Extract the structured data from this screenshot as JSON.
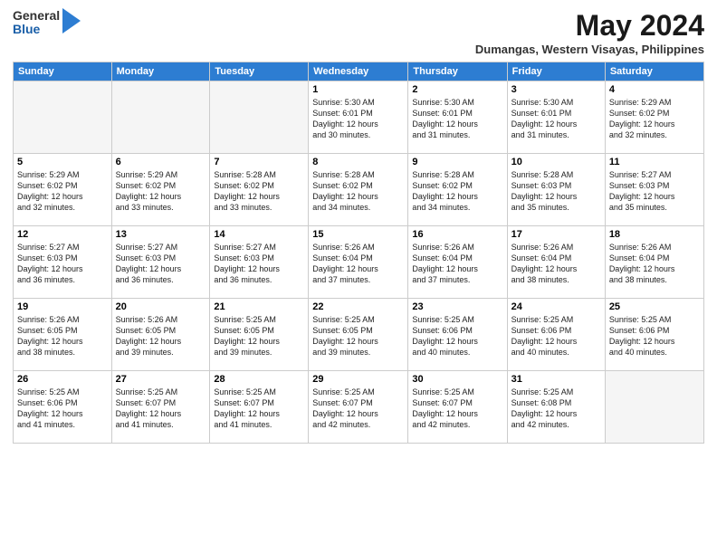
{
  "logo": {
    "general": "General",
    "blue": "Blue"
  },
  "title": "May 2024",
  "location": "Dumangas, Western Visayas, Philippines",
  "days_of_week": [
    "Sunday",
    "Monday",
    "Tuesday",
    "Wednesday",
    "Thursday",
    "Friday",
    "Saturday"
  ],
  "weeks": [
    [
      {
        "day": "",
        "info": ""
      },
      {
        "day": "",
        "info": ""
      },
      {
        "day": "",
        "info": ""
      },
      {
        "day": "1",
        "info": "Sunrise: 5:30 AM\nSunset: 6:01 PM\nDaylight: 12 hours\nand 30 minutes."
      },
      {
        "day": "2",
        "info": "Sunrise: 5:30 AM\nSunset: 6:01 PM\nDaylight: 12 hours\nand 31 minutes."
      },
      {
        "day": "3",
        "info": "Sunrise: 5:30 AM\nSunset: 6:01 PM\nDaylight: 12 hours\nand 31 minutes."
      },
      {
        "day": "4",
        "info": "Sunrise: 5:29 AM\nSunset: 6:02 PM\nDaylight: 12 hours\nand 32 minutes."
      }
    ],
    [
      {
        "day": "5",
        "info": "Sunrise: 5:29 AM\nSunset: 6:02 PM\nDaylight: 12 hours\nand 32 minutes."
      },
      {
        "day": "6",
        "info": "Sunrise: 5:29 AM\nSunset: 6:02 PM\nDaylight: 12 hours\nand 33 minutes."
      },
      {
        "day": "7",
        "info": "Sunrise: 5:28 AM\nSunset: 6:02 PM\nDaylight: 12 hours\nand 33 minutes."
      },
      {
        "day": "8",
        "info": "Sunrise: 5:28 AM\nSunset: 6:02 PM\nDaylight: 12 hours\nand 34 minutes."
      },
      {
        "day": "9",
        "info": "Sunrise: 5:28 AM\nSunset: 6:02 PM\nDaylight: 12 hours\nand 34 minutes."
      },
      {
        "day": "10",
        "info": "Sunrise: 5:28 AM\nSunset: 6:03 PM\nDaylight: 12 hours\nand 35 minutes."
      },
      {
        "day": "11",
        "info": "Sunrise: 5:27 AM\nSunset: 6:03 PM\nDaylight: 12 hours\nand 35 minutes."
      }
    ],
    [
      {
        "day": "12",
        "info": "Sunrise: 5:27 AM\nSunset: 6:03 PM\nDaylight: 12 hours\nand 36 minutes."
      },
      {
        "day": "13",
        "info": "Sunrise: 5:27 AM\nSunset: 6:03 PM\nDaylight: 12 hours\nand 36 minutes."
      },
      {
        "day": "14",
        "info": "Sunrise: 5:27 AM\nSunset: 6:03 PM\nDaylight: 12 hours\nand 36 minutes."
      },
      {
        "day": "15",
        "info": "Sunrise: 5:26 AM\nSunset: 6:04 PM\nDaylight: 12 hours\nand 37 minutes."
      },
      {
        "day": "16",
        "info": "Sunrise: 5:26 AM\nSunset: 6:04 PM\nDaylight: 12 hours\nand 37 minutes."
      },
      {
        "day": "17",
        "info": "Sunrise: 5:26 AM\nSunset: 6:04 PM\nDaylight: 12 hours\nand 38 minutes."
      },
      {
        "day": "18",
        "info": "Sunrise: 5:26 AM\nSunset: 6:04 PM\nDaylight: 12 hours\nand 38 minutes."
      }
    ],
    [
      {
        "day": "19",
        "info": "Sunrise: 5:26 AM\nSunset: 6:05 PM\nDaylight: 12 hours\nand 38 minutes."
      },
      {
        "day": "20",
        "info": "Sunrise: 5:26 AM\nSunset: 6:05 PM\nDaylight: 12 hours\nand 39 minutes."
      },
      {
        "day": "21",
        "info": "Sunrise: 5:25 AM\nSunset: 6:05 PM\nDaylight: 12 hours\nand 39 minutes."
      },
      {
        "day": "22",
        "info": "Sunrise: 5:25 AM\nSunset: 6:05 PM\nDaylight: 12 hours\nand 39 minutes."
      },
      {
        "day": "23",
        "info": "Sunrise: 5:25 AM\nSunset: 6:06 PM\nDaylight: 12 hours\nand 40 minutes."
      },
      {
        "day": "24",
        "info": "Sunrise: 5:25 AM\nSunset: 6:06 PM\nDaylight: 12 hours\nand 40 minutes."
      },
      {
        "day": "25",
        "info": "Sunrise: 5:25 AM\nSunset: 6:06 PM\nDaylight: 12 hours\nand 40 minutes."
      }
    ],
    [
      {
        "day": "26",
        "info": "Sunrise: 5:25 AM\nSunset: 6:06 PM\nDaylight: 12 hours\nand 41 minutes."
      },
      {
        "day": "27",
        "info": "Sunrise: 5:25 AM\nSunset: 6:07 PM\nDaylight: 12 hours\nand 41 minutes."
      },
      {
        "day": "28",
        "info": "Sunrise: 5:25 AM\nSunset: 6:07 PM\nDaylight: 12 hours\nand 41 minutes."
      },
      {
        "day": "29",
        "info": "Sunrise: 5:25 AM\nSunset: 6:07 PM\nDaylight: 12 hours\nand 42 minutes."
      },
      {
        "day": "30",
        "info": "Sunrise: 5:25 AM\nSunset: 6:07 PM\nDaylight: 12 hours\nand 42 minutes."
      },
      {
        "day": "31",
        "info": "Sunrise: 5:25 AM\nSunset: 6:08 PM\nDaylight: 12 hours\nand 42 minutes."
      },
      {
        "day": "",
        "info": ""
      }
    ]
  ]
}
